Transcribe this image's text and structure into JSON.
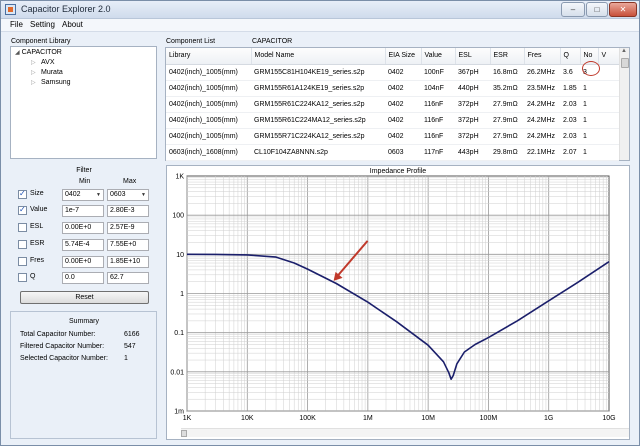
{
  "window": {
    "title": "Capacitor Explorer 2.0",
    "controls": {
      "minimize": "–",
      "maximize": "□",
      "close": "✕"
    }
  },
  "menu": [
    "File",
    "Setting",
    "About"
  ],
  "library": {
    "label": "Component Library",
    "root": "CAPACITOR",
    "children": [
      "AVX",
      "Murata",
      "Samsung"
    ]
  },
  "filter": {
    "title": "Filter",
    "min_label": "Min",
    "max_label": "Max",
    "rows": [
      {
        "label": "Size",
        "checked": true,
        "min": "0402",
        "max": "0603",
        "select": true
      },
      {
        "label": "Value",
        "checked": true,
        "min": "1e-7",
        "max": "2.80E-3",
        "select": false
      },
      {
        "label": "ESL",
        "checked": false,
        "min": "0.00E+0",
        "max": "2.57E-9",
        "select": false
      },
      {
        "label": "ESR",
        "checked": false,
        "min": "5.74E-4",
        "max": "7.55E+0",
        "select": false
      },
      {
        "label": "Fres",
        "checked": false,
        "min": "0.00E+0",
        "max": "1.85E+10",
        "select": false
      },
      {
        "label": "Q",
        "checked": false,
        "min": "0.0",
        "max": "62.7",
        "select": false
      }
    ],
    "reset_label": "Reset"
  },
  "summary": {
    "title": "Summary",
    "rows": [
      {
        "label": "Total Capacitor Number:",
        "value": "6166"
      },
      {
        "label": "Filtered Capacitor Number:",
        "value": "547"
      },
      {
        "label": "Selected Capacitor Number:",
        "value": "1"
      }
    ]
  },
  "component_list": {
    "label": "Component List",
    "category": "CAPACITOR",
    "columns": [
      "Library",
      "Model Name",
      "EIA Size",
      "Value",
      "ESL",
      "ESR",
      "Fres",
      "Q",
      "No",
      "V"
    ],
    "rows": [
      [
        "0402(inch)_1005(mm)",
        "GRM155C81H104KE19_series.s2p",
        "0402",
        "100nF",
        "367pH",
        "16.8mΩ",
        "26.2MHz",
        "3.6",
        "3",
        ""
      ],
      [
        "0402(inch)_1005(mm)",
        "GRM155R61A124KE19_series.s2p",
        "0402",
        "104nF",
        "440pH",
        "35.2mΩ",
        "23.5MHz",
        "1.85",
        "1",
        ""
      ],
      [
        "0402(inch)_1005(mm)",
        "GRM155R61C224KA12_series.s2p",
        "0402",
        "116nF",
        "372pH",
        "27.9mΩ",
        "24.2MHz",
        "2.03",
        "1",
        ""
      ],
      [
        "0402(inch)_1005(mm)",
        "GRM155R61C224MA12_series.s2p",
        "0402",
        "116nF",
        "372pH",
        "27.9mΩ",
        "24.2MHz",
        "2.03",
        "1",
        ""
      ],
      [
        "0402(inch)_1005(mm)",
        "GRM155R71C224KA12_series.s2p",
        "0402",
        "116nF",
        "372pH",
        "27.9mΩ",
        "24.2MHz",
        "2.03",
        "1",
        ""
      ],
      [
        "0603(inch)_1608(mm)",
        "CL10F104ZA8NNN.s2p",
        "0603",
        "117nF",
        "443pH",
        "29.8mΩ",
        "22.1MHz",
        "2.07",
        "1",
        ""
      ]
    ]
  },
  "impedance_chart": {
    "title": "Impedance Profile",
    "x_ticks": [
      "1K",
      "10K",
      "100K",
      "1M",
      "10M",
      "100M",
      "1G",
      "10G"
    ],
    "y_ticks": [
      "1K",
      "100",
      "10",
      "1",
      "0.1",
      "0.01",
      "1m"
    ],
    "x_range_hz": [
      1000,
      10000000000
    ],
    "y_range_ohm": [
      0.001,
      1000
    ],
    "line_color": "#1b1f6b",
    "arrow_color": "#c0392b",
    "curve": {
      "x_hz": [
        1000,
        3000,
        10000,
        30000,
        60000,
        100000,
        300000,
        1000000,
        3000000,
        10000000,
        18000000,
        22000000,
        24000000,
        26000000,
        30000000,
        40000000,
        60000000,
        100000000,
        300000000,
        1000000000,
        3000000000,
        10000000000
      ],
      "z_ohm": [
        10.0,
        9.95,
        9.7,
        8.5,
        6.0,
        4.2,
        1.8,
        0.6,
        0.19,
        0.048,
        0.018,
        0.0095,
        0.0065,
        0.008,
        0.016,
        0.032,
        0.05,
        0.075,
        0.2,
        0.65,
        1.9,
        6.5
      ]
    },
    "arrow_tip": {
      "x_hz": 270000,
      "z_ohm": 2.1
    }
  }
}
